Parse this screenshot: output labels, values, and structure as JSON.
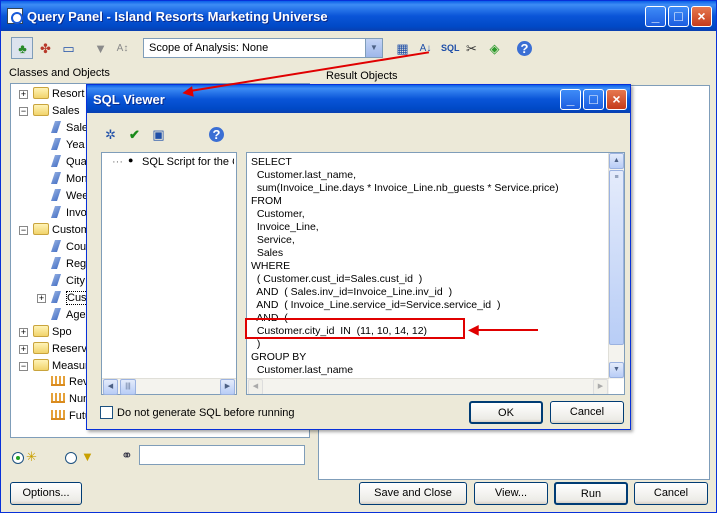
{
  "main_window": {
    "title": "Query Panel - Island Resorts Marketing Universe",
    "scope_label": "Scope of Analysis: None",
    "classes_label": "Classes and Objects",
    "result_label": "Result Objects",
    "buttons": {
      "options": "Options...",
      "save_close": "Save and Close",
      "view": "View...",
      "run": "Run",
      "cancel": "Cancel"
    }
  },
  "tree": [
    {
      "label": "Resort",
      "kind": "folder",
      "expander": "+"
    },
    {
      "label": "Sales",
      "kind": "folder",
      "expander": "−"
    },
    {
      "label": "Sale",
      "kind": "object"
    },
    {
      "label": "Yea",
      "kind": "object"
    },
    {
      "label": "Qua",
      "kind": "object"
    },
    {
      "label": "Mon",
      "kind": "object"
    },
    {
      "label": "Wee",
      "kind": "object"
    },
    {
      "label": "Invo",
      "kind": "object"
    },
    {
      "label": "Custom",
      "kind": "folder",
      "expander": "−"
    },
    {
      "label": "Cou",
      "kind": "object"
    },
    {
      "label": "Reg",
      "kind": "object"
    },
    {
      "label": "City",
      "kind": "object"
    },
    {
      "label": "Cus",
      "kind": "object",
      "expander": "+"
    },
    {
      "label": "Age",
      "kind": "object"
    },
    {
      "label": "Spo",
      "kind": "folder",
      "expander": "+"
    },
    {
      "label": "Reserv",
      "kind": "folder",
      "expander": "+"
    },
    {
      "label": "Measur",
      "kind": "folder",
      "expander": "−"
    },
    {
      "label": "Rev",
      "kind": "measure"
    },
    {
      "label": "Num",
      "kind": "measure"
    },
    {
      "label": "Futu",
      "kind": "measure"
    }
  ],
  "sql_viewer": {
    "title": "SQL Viewer",
    "tree_item": "SQL Script for the Q",
    "sql_lines": [
      "SELECT",
      "  Customer.last_name,",
      "  sum(Invoice_Line.days * Invoice_Line.nb_guests * Service.price)",
      "FROM",
      "  Customer,",
      "  Invoice_Line,",
      "  Service,",
      "  Sales",
      "WHERE",
      "  ( Customer.cust_id=Sales.cust_id  )",
      "  AND  ( Sales.inv_id=Invoice_Line.inv_id  )",
      "  AND  ( Invoice_Line.service_id=Service.service_id  )",
      "  AND  (",
      "  Customer.city_id  IN  (11, 10, 14, 12)",
      "  )",
      "GROUP BY",
      "  Customer.last_name"
    ],
    "checkbox_label": "Do not generate SQL before running",
    "ok": "OK",
    "cancel": "Cancel"
  },
  "colors": {
    "title_bar": "#0a55d8",
    "annotation": "#e00000",
    "window_bg": "#ece9d8"
  }
}
